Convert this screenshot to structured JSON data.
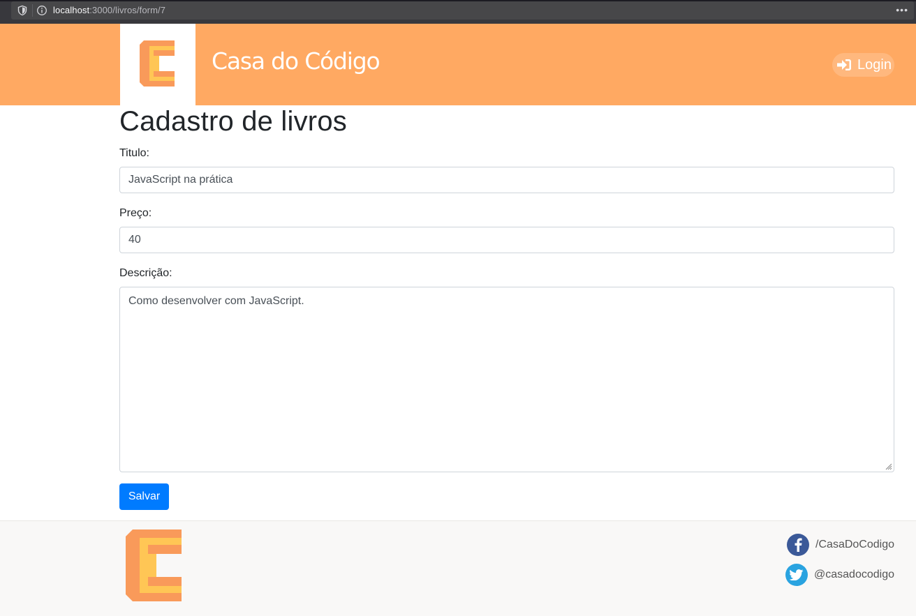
{
  "browser": {
    "url_host": "localhost",
    "url_path": ":3000/livros/form/7",
    "menu_dots": "•••"
  },
  "header": {
    "brand": "Casa do Código",
    "login_label": "Login",
    "colors": {
      "header_bg": "#ffa962",
      "logo_orange": "#f99a5a",
      "logo_yellow": "#ffc655"
    }
  },
  "form": {
    "title": "Cadastro de livros",
    "titulo": {
      "label": "Titulo:",
      "value": "JavaScript na prática"
    },
    "preco": {
      "label": "Preço:",
      "value": "40"
    },
    "descricao": {
      "label": "Descrição:",
      "value": "Como desenvolver com JavaScript."
    },
    "submit_label": "Salvar",
    "colors": {
      "submit_bg": "#007bff"
    }
  },
  "footer": {
    "facebook": {
      "icon": "facebook-icon",
      "label": "/CasaDoCodigo"
    },
    "twitter": {
      "icon": "twitter-icon",
      "label": "@casadocodigo"
    }
  }
}
